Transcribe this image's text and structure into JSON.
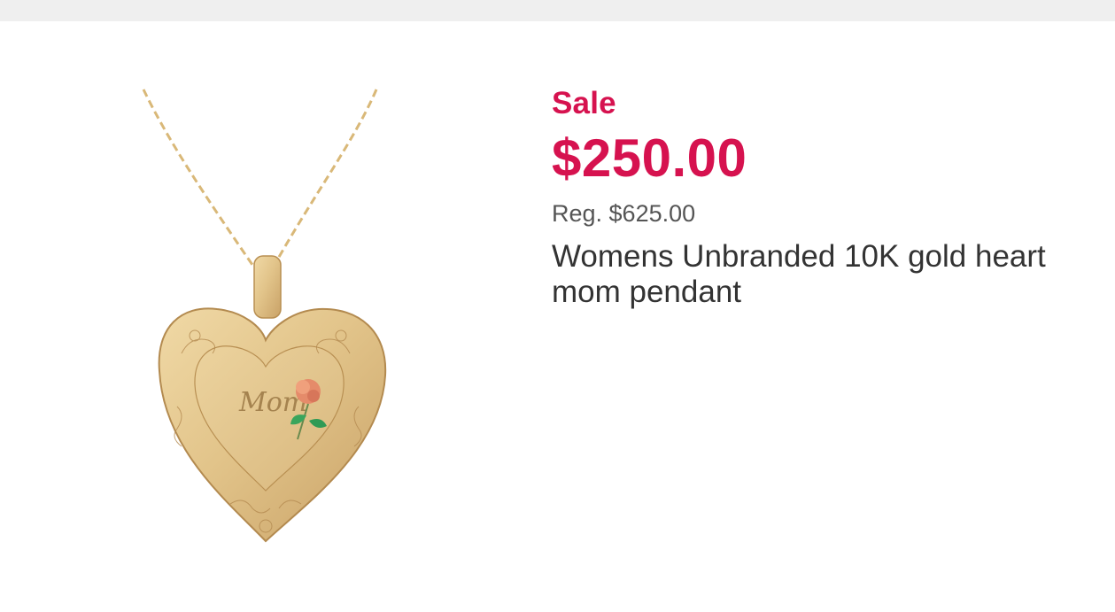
{
  "product": {
    "sale_label": "Sale",
    "sale_price": "$250.00",
    "regular_price": "Reg. $625.00",
    "title": "Womens Unbranded 10K gold heart mom pendant",
    "locket_engraving": "Mom"
  },
  "colors": {
    "sale": "#d6124f",
    "gold": "#d9b878",
    "text": "#333333",
    "muted": "#555555",
    "top_bar": "#efefef"
  }
}
